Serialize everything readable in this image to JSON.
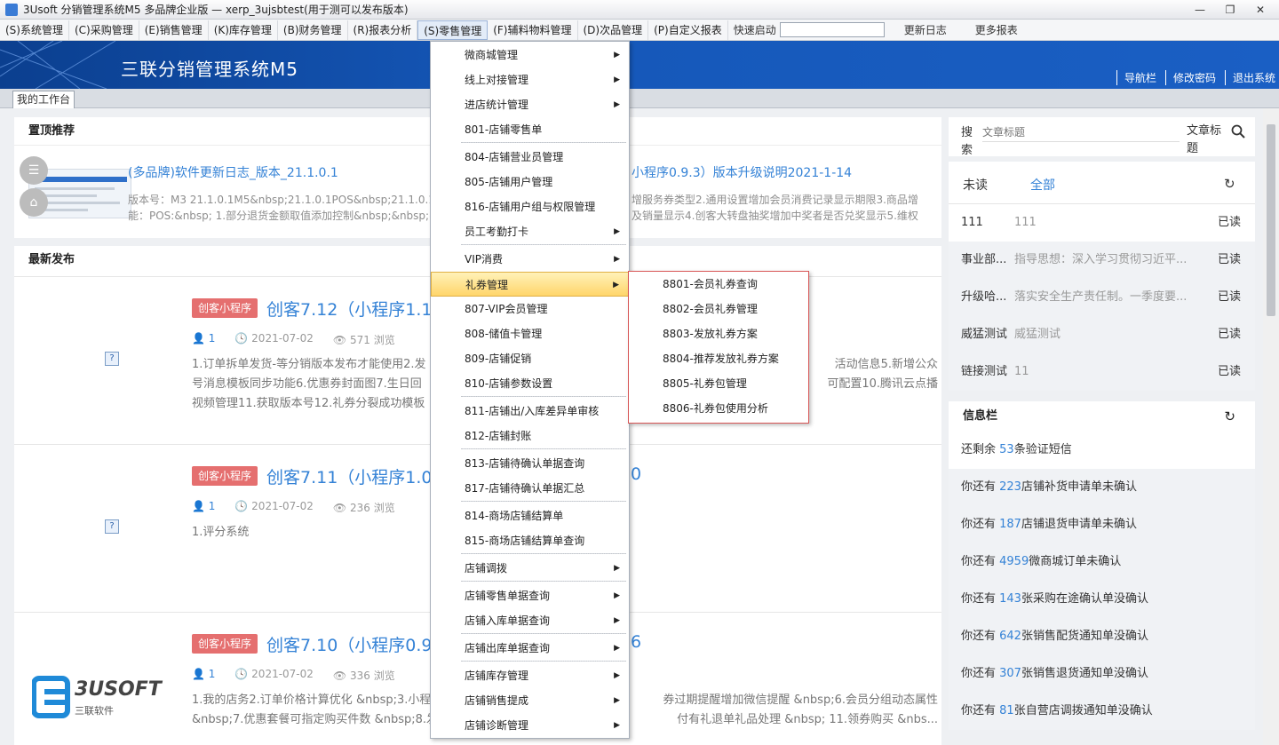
{
  "window": {
    "title": "3Usoft 分销管理系统M5 多品牌企业版 — xerp_3ujsbtest(用于测可以发布版本)"
  },
  "menubar": {
    "items": [
      "(S)系统管理",
      "(C)采购管理",
      "(E)销售管理",
      "(K)库存管理",
      "(B)财务管理",
      "(R)报表分析",
      "(S)零售管理",
      "(F)辅料物料管理",
      "(D)次品管理",
      "(P)自定义报表"
    ],
    "quick_start": "快速启动",
    "changelog": "更新日志",
    "more_reports": "更多报表"
  },
  "banner": {
    "brand": "三联分销管理系统M5",
    "links": [
      "导航栏",
      "修改密码",
      "退出系统"
    ]
  },
  "tab": {
    "workspace": "我的工作台"
  },
  "pinned": {
    "heading": "置顶推荐",
    "title1": "(多品牌)软件更新日志_版本_21.1.0.1",
    "title2": "小程序0.9.3）版本升级说明2021-1-14",
    "desc_left": "版本号：M3 21.1.0.1M5&nbsp;21.1.0.1POS&nbsp;21.1.0.1主要...",
    "desc_left2": "能：POS:&nbsp; 1.部分退货金额取值添加控制&nbsp;&nbsp;&n",
    "desc_right": "增服务券类型2.通用设置增加会员消费记录显示期限3.商品增",
    "desc_right2": "及销量显示4.创客大转盘抽奖增加中奖者是否兑奖显示5.维权"
  },
  "latest": {
    "heading": "最新发布",
    "posts": [
      {
        "badge": "创客小程序",
        "title": "创客7.12（小程序1.1.0",
        "author": "1",
        "date": "2021-07-02",
        "views": "571 浏览",
        "desc1": "1.订单拆单发货-等分销版本发布才能使用2.发",
        "desc1b": "活动信息5.新增公众",
        "desc2": "号消息模板同步功能6.优惠券封面图7.生日回",
        "desc2b": "可配置10.腾讯云点播",
        "desc3": "视频管理11.获取版本号12.礼券分裂成功模板"
      },
      {
        "badge": "创客小程序",
        "title": "创客7.11（小程序1.0.2",
        "title_tail": "0",
        "author": "1",
        "date": "2021-07-02",
        "views": "236 浏览",
        "desc1": "1.评分系统"
      },
      {
        "badge": "创客小程序",
        "title": "创客7.10（小程序0.9.8",
        "title_tail": "6",
        "author": "1",
        "date": "2021-07-02",
        "views": "336 浏览",
        "desc1": "1.我的店务2.订单价格计算优化 &nbsp;3.小程",
        "desc1b": "券过期提醒增加微信提醒 &nbsp;6.会员分组动态属性",
        "desc2": "&nbsp;7.优惠套餐可指定购买件数 &nbsp;8.发",
        "desc2b": "付有礼退单礼品处理 &nbsp; 11.领券购买 &nbs..."
      }
    ]
  },
  "search": {
    "label": "搜索",
    "placeholder": "文章标题",
    "label2": "文章标题"
  },
  "reads": {
    "tab_unread": "未读",
    "tab_all": "全部",
    "rows": [
      {
        "a": "111",
        "b": "111",
        "c": "已读"
      },
      {
        "a": "事业部...",
        "b": "指导思想：深入学习贯彻习近平...",
        "c": "已读"
      },
      {
        "a": "升级哈...",
        "b": "落实安全生产责任制。一季度要...",
        "c": "已读"
      },
      {
        "a": "威猛测试",
        "b": "威猛测试",
        "c": "已读"
      },
      {
        "a": "链接测试",
        "b": "11",
        "c": "已读"
      }
    ]
  },
  "info": {
    "heading": "信息栏",
    "rows": [
      {
        "pre": "还剩余 ",
        "num": "53",
        "post": "条验证短信"
      },
      {
        "pre": "你还有 ",
        "num": "223",
        "post": "店铺补货申请单未确认"
      },
      {
        "pre": "你还有 ",
        "num": "187",
        "post": "店铺退货申请单未确认"
      },
      {
        "pre": "你还有 ",
        "num": "4959",
        "post": "微商城订单未确认"
      },
      {
        "pre": "你还有 ",
        "num": "143",
        "post": "张采购在途确认单没确认"
      },
      {
        "pre": "你还有 ",
        "num": "642",
        "post": "张销售配货通知单没确认"
      },
      {
        "pre": "你还有 ",
        "num": "307",
        "post": "张销售退货通知单没确认"
      },
      {
        "pre": "你还有 ",
        "num": "81",
        "post": "张自营店调拨通知单没确认"
      }
    ]
  },
  "dropdown": {
    "items": [
      {
        "label": "微商城管理",
        "arrow": "▶"
      },
      {
        "label": "线上对接管理",
        "arrow": "▶"
      },
      {
        "label": "进店统计管理",
        "arrow": "▶"
      },
      {
        "label": "801-店铺零售单"
      },
      {
        "label": "804-店铺营业员管理"
      },
      {
        "label": "805-店铺用户管理"
      },
      {
        "label": "816-店铺用户组与权限管理"
      },
      {
        "label": "员工考勤打卡",
        "arrow": "▶"
      },
      {
        "label": "VIP消费",
        "arrow": "▶"
      },
      {
        "label": "礼券管理",
        "arrow": "▶"
      },
      {
        "label": "807-VIP会员管理"
      },
      {
        "label": "808-储值卡管理"
      },
      {
        "label": "809-店铺促销"
      },
      {
        "label": "810-店铺参数设置"
      },
      {
        "label": "811-店铺出/入库差异单审核"
      },
      {
        "label": "812-店铺封账"
      },
      {
        "label": "813-店铺待确认单据查询"
      },
      {
        "label": "817-店铺待确认单据汇总"
      },
      {
        "label": "814-商场店铺结算单"
      },
      {
        "label": "815-商场店铺结算单查询"
      },
      {
        "label": "店铺调拨",
        "arrow": "▶"
      },
      {
        "label": "店铺零售单据查询",
        "arrow": "▶"
      },
      {
        "label": "店铺入库单据查询",
        "arrow": "▶"
      },
      {
        "label": "店铺出库单据查询",
        "arrow": "▶"
      },
      {
        "label": "店铺库存管理",
        "arrow": "▶"
      },
      {
        "label": "店铺销售提成",
        "arrow": "▶"
      },
      {
        "label": "店铺诊断管理",
        "arrow": "▶"
      }
    ]
  },
  "submenu": {
    "items": [
      "8801-会员礼券查询",
      "8802-会员礼券管理",
      "8803-发放礼券方案",
      "8804-推荐发放礼券方案",
      "8805-礼券包管理",
      "8806-礼券包使用分析"
    ]
  },
  "logo": {
    "text": "3USOFT",
    "sub": "三联软件"
  },
  "colors": {
    "accent": "#3482d6",
    "banner": "#1557b8",
    "badge": "#e56f6f"
  }
}
